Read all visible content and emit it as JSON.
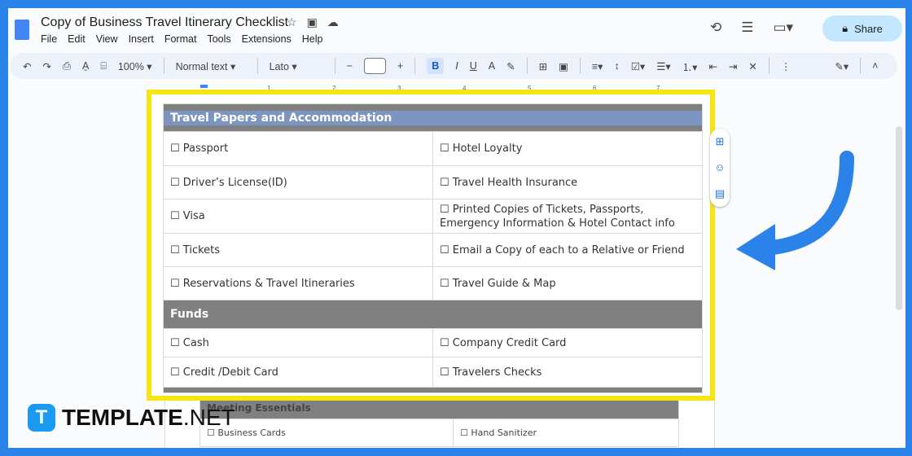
{
  "doc": {
    "title": "Copy of Business Travel Itinerary Checklist",
    "menu": [
      "File",
      "Edit",
      "View",
      "Insert",
      "Format",
      "Tools",
      "Extensions",
      "Help"
    ],
    "share": "Share"
  },
  "toolbar": {
    "zoom": "100%",
    "style": "Normal text",
    "font": "Lato",
    "size": ""
  },
  "ruler": [
    "1",
    "2",
    "3",
    "4",
    "5",
    "6",
    "7"
  ],
  "table1": {
    "sections": [
      {
        "title": "Travel Papers and Accommodation",
        "rows": [
          [
            "☐ Passport",
            "☐ Hotel Loyalty"
          ],
          [
            "☐ Driver’s License(ID)",
            "☐ Travel Health Insurance"
          ],
          [
            "☐ Visa",
            "☐ Printed Copies of Tickets, Passports, Emergency Information & Hotel Contact info"
          ],
          [
            "☐ Tickets",
            "☐ Email a Copy of each to a Relative or Friend"
          ],
          [
            "☐ Reservations & Travel Itineraries",
            "☐ Travel Guide & Map"
          ]
        ]
      },
      {
        "title": "Funds",
        "rows": [
          [
            "☐ Cash",
            "☐ Company Credit Card"
          ],
          [
            "☐ Credit /Debit Card",
            "☐ Travelers Checks"
          ]
        ]
      }
    ]
  },
  "table2": {
    "title": "Meeting Essentials",
    "rows": [
      [
        "☐ Business Cards",
        "☐ Hand Sanitizer"
      ]
    ]
  },
  "brand": {
    "name": "TEMPLATE",
    "suffix": ".NET",
    "frame_color": "#2b82e8",
    "highlight_color": "#f7e512"
  }
}
